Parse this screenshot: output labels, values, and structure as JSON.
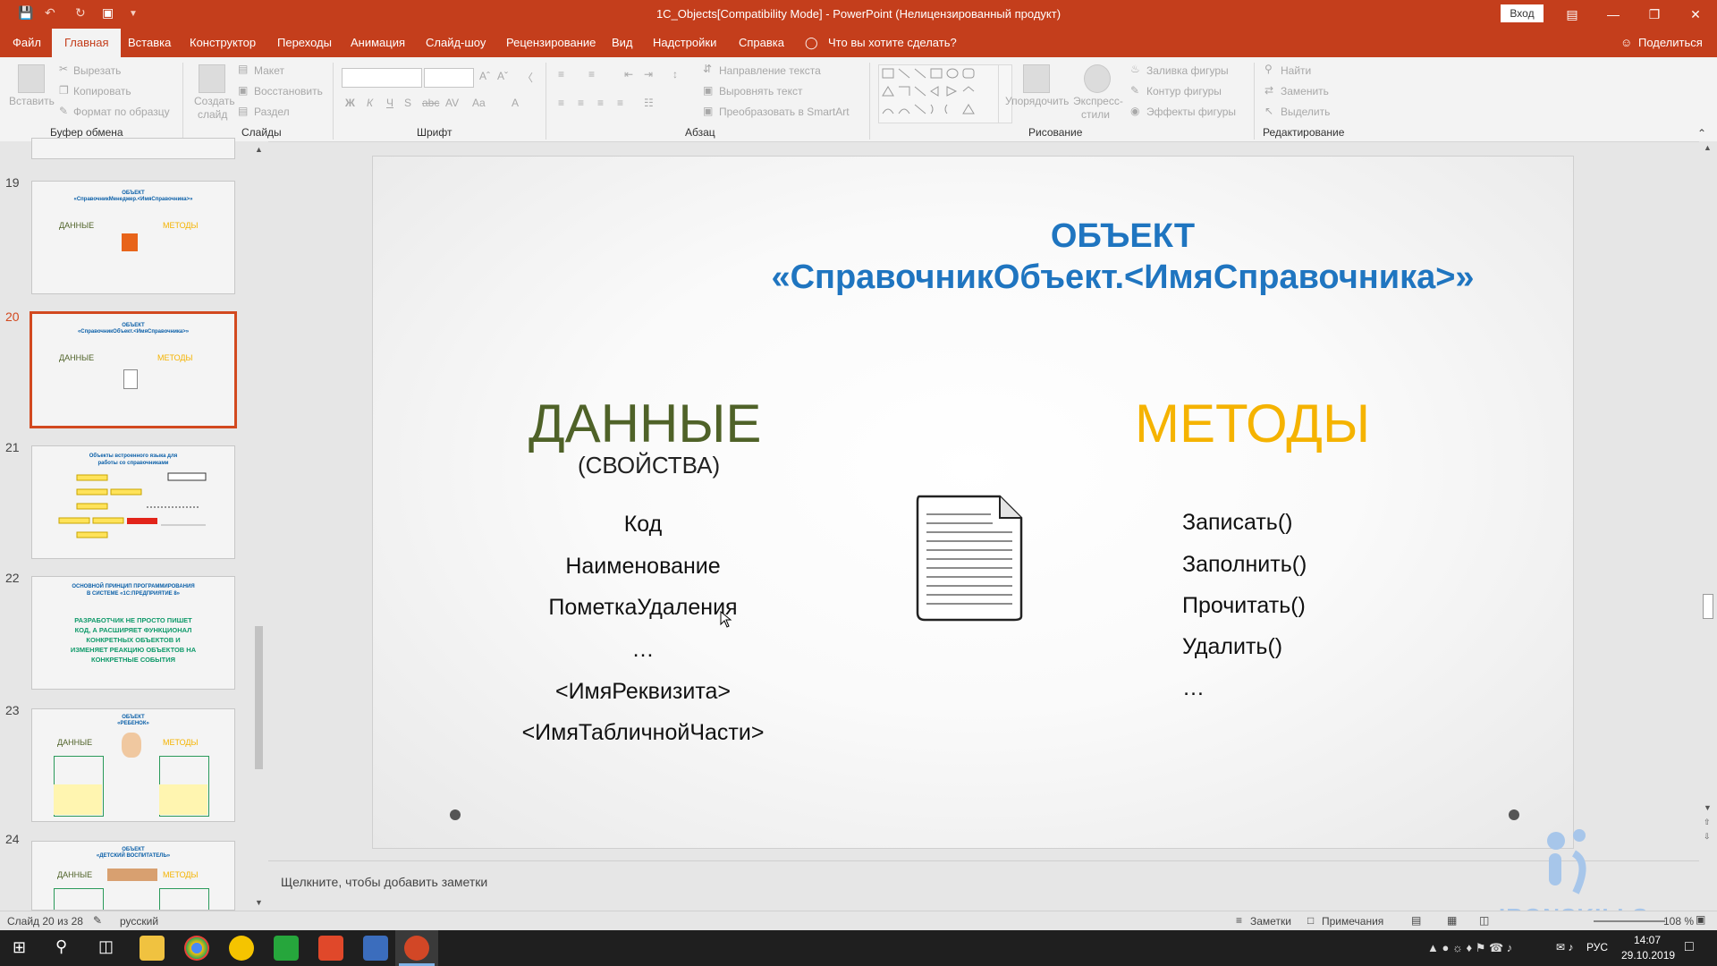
{
  "window": {
    "title": "1C_Objects[Compatibility Mode]  -  PowerPoint (Нелицензированный продукт)",
    "login_label": "Вход"
  },
  "tabs": [
    "Файл",
    "Главная",
    "Вставка",
    "Конструктор",
    "Переходы",
    "Анимация",
    "Слайд-шоу",
    "Рецензирование",
    "Вид",
    "Надстройки",
    "Справка"
  ],
  "tell_me": "Что вы хотите сделать?",
  "share_label": "Поделиться",
  "ribbon": {
    "clipboard": {
      "label": "Буфер обмена",
      "paste": "Вставить",
      "cut": "Вырезать",
      "copy": "Копировать",
      "format_painter": "Формат по образцу"
    },
    "slides": {
      "label": "Слайды",
      "new_slide_1": "Создать",
      "new_slide_2": "слайд",
      "layout": "Макет",
      "reset": "Восстановить",
      "section": "Раздел"
    },
    "font": {
      "label": "Шрифт"
    },
    "paragraph": {
      "label": "Абзац",
      "text_direction": "Направление текста",
      "align_text": "Выровнять текст",
      "smartart": "Преобразовать в SmartArt"
    },
    "drawing": {
      "label": "Рисование",
      "arrange": "Упорядочить",
      "quick_styles_1": "Экспресс-",
      "quick_styles_2": "стили",
      "fill": "Заливка фигуры",
      "outline": "Контур фигуры",
      "effects": "Эффекты фигуры"
    },
    "editing": {
      "label": "Редактирование",
      "find": "Найти",
      "replace": "Заменить",
      "select": "Выделить"
    }
  },
  "thumbnails": [
    {
      "num": "19",
      "title1": "ОБЪЕКТ",
      "title2": "«СправочникМенеджер.<ИмяСправочника>»",
      "left": "ДАННЫЕ",
      "right": "МЕТОДЫ"
    },
    {
      "num": "20",
      "title1": "ОБЪЕКТ",
      "title2": "«СправочникОбъект.<ИмяСправочника>»",
      "left": "ДАННЫЕ",
      "right": "МЕТОДЫ"
    },
    {
      "num": "21",
      "title1": "Объекты встроенного языка для",
      "title2": "работы со справочниками"
    },
    {
      "num": "22",
      "title1": "ОСНОВНОЙ ПРИНЦИП ПРОГРАММИРОВАНИЯ",
      "title2": "В СИСТЕМЕ «1С:ПРЕДПРИЯТИЕ 8»",
      "body": [
        "РАЗРАБОТЧИК НЕ ПРОСТО ПИШЕТ",
        "КОД, А РАСШИРЯЕТ ФУНКЦИОНАЛ",
        "КОНКРЕТНЫХ ОБЪЕКТОВ И",
        "ИЗМЕНЯЕТ РЕАКЦИЮ ОБЪЕКТОВ НА",
        "КОНКРЕТНЫЕ СОБЫТИЯ"
      ]
    },
    {
      "num": "23",
      "title1": "ОБЪЕКТ",
      "title2": "«РЕБЕНОК»",
      "left": "ДАННЫЕ",
      "right": "МЕТОДЫ"
    },
    {
      "num": "24",
      "title1": "ОБЪЕКТ",
      "title2": "«ДЕТСКИЙ ВОСПИТАТЕЛЬ»",
      "left": "ДАННЫЕ",
      "right": "МЕТОДЫ"
    }
  ],
  "slide": {
    "title_line1": "ОБЪЕКТ",
    "title_line2": "«СправочникОбъект.<ИмяСправочника>»",
    "data_heading": "ДАННЫЕ",
    "data_subheading": "(СВОЙСТВА)",
    "data_items": [
      "Код",
      "Наименование",
      "ПометкаУдаления",
      "…",
      "<ИмяРеквизита>",
      "<ИмяТабличнойЧасти>"
    ],
    "methods_heading": "МЕТОДЫ",
    "method_items": [
      "Записать()",
      "Заполнить()",
      "Прочитать()",
      "Удалить()",
      "…"
    ]
  },
  "notes_placeholder": "Щелкните, чтобы добавить заметки",
  "status": {
    "slide_counter": "Слайд 20 из 28",
    "language": "русский",
    "notes_btn": "Заметки",
    "comments_btn": "Примечания",
    "zoom": "108 %"
  },
  "watermark": "IRONSKILLS",
  "taskbar": {
    "lang": "РУС",
    "time": "14:07",
    "date": "29.10.2019"
  },
  "colors": {
    "accent": "#c43e1c",
    "title_blue": "#1f75c0",
    "data_green": "#4f6228",
    "methods_yellow": "#f5b300"
  }
}
